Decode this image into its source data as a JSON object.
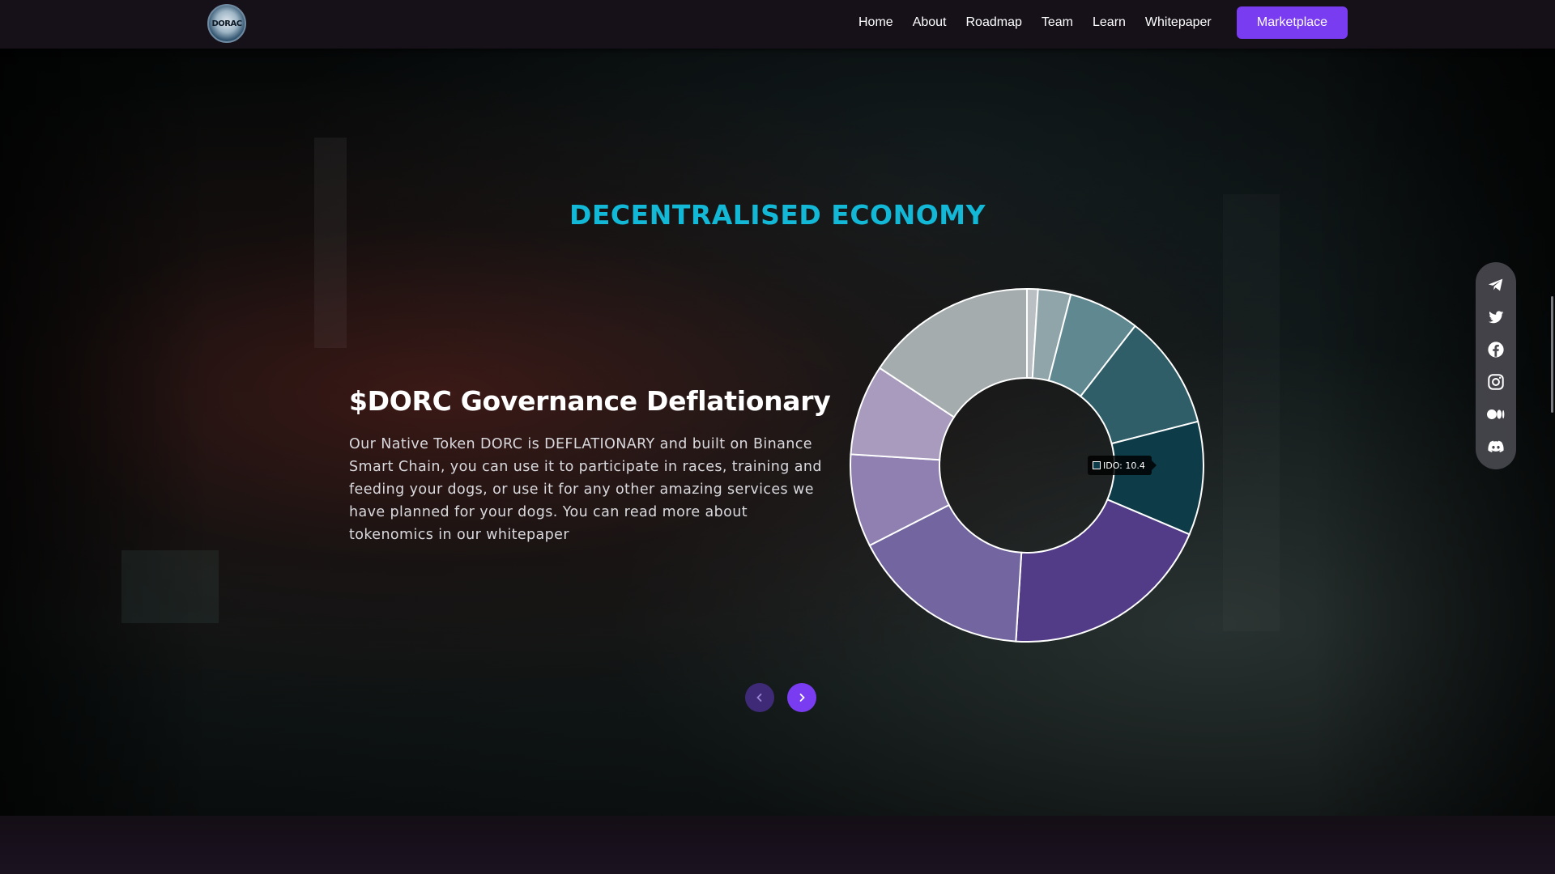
{
  "nav": {
    "logo_text": "DORAC",
    "links": [
      "Home",
      "About",
      "Roadmap",
      "Team",
      "Learn",
      "Whitepaper"
    ],
    "cta_label": "Marketplace"
  },
  "section": {
    "title": "DECENTRALISED ECONOMY"
  },
  "slide": {
    "title": "$DORC Governance Deflationary",
    "text": "Our Native Token DORC is DEFLATIONARY and built on Binance Smart Chain, you can use it to participate in races, training and feeding your dogs, or use it for any other amazing services we have planned for your dogs. You can read more about tokenomics in our whitepaper"
  },
  "tooltip": {
    "text": "IDO: 10.4"
  },
  "chart_data": {
    "type": "pie",
    "variant": "donut",
    "start_angle_deg": 0,
    "slices": [
      {
        "value": 1.0,
        "color": "#b9bfc2"
      },
      {
        "value": 3.0,
        "color": "#8fa5aa"
      },
      {
        "value": 6.5,
        "color": "#5f8890"
      },
      {
        "value": 10.5,
        "color": "#2f5e68"
      },
      {
        "value": 10.4,
        "color": "#0d3b47"
      },
      {
        "value": 19.6,
        "color": "#523b87"
      },
      {
        "value": 16.5,
        "color": "#73659f"
      },
      {
        "value": 8.5,
        "color": "#8f80b1"
      },
      {
        "value": 8.3,
        "color": "#a89bbd"
      },
      {
        "value": 15.7,
        "color": "#a4acad"
      }
    ]
  },
  "icons": [
    "telegram-icon",
    "twitter-icon",
    "facebook-icon",
    "instagram-icon",
    "medium-icon",
    "discord-icon"
  ]
}
